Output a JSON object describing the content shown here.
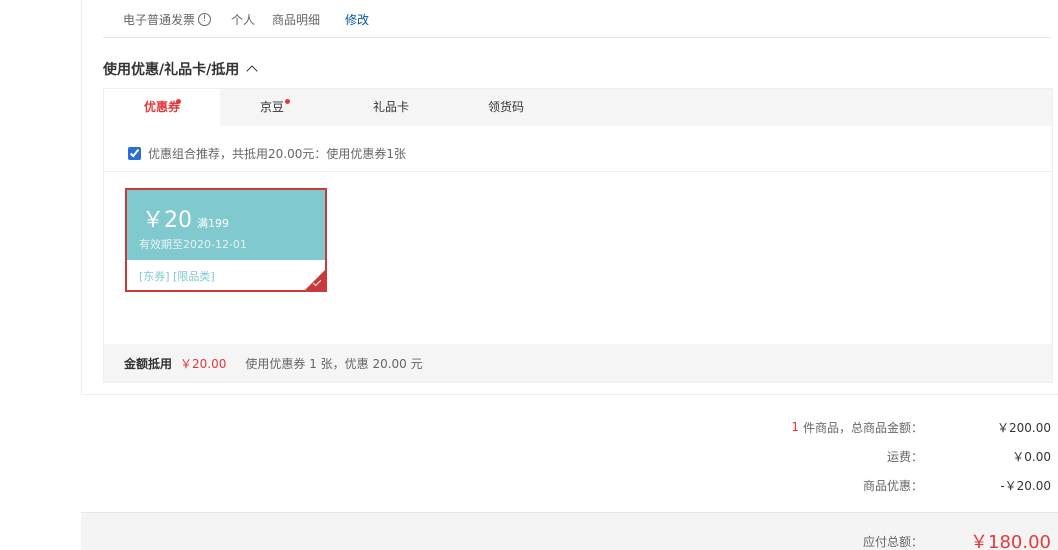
{
  "invoice": {
    "type": "电子普通发票",
    "info_icon": "!",
    "title": "个人",
    "content": "商品明细",
    "modify": "修改"
  },
  "discount_section": {
    "title": "使用优惠/礼品卡/抵用",
    "tabs": [
      {
        "label": "优惠券",
        "dot": true,
        "active": true
      },
      {
        "label": "京豆",
        "dot": true,
        "active": false
      },
      {
        "label": "礼品卡",
        "dot": false,
        "active": false
      },
      {
        "label": "领货码",
        "dot": false,
        "active": false
      }
    ],
    "recommend_text": "优惠组合推荐，共抵用20.00元：使用优惠券1张",
    "recommend_checked": true,
    "coupon": {
      "amount": "￥20",
      "condition": "满199",
      "expiry": "有效期至2020-12-01",
      "tags": "[东券] [限品类]",
      "selected": true,
      "color": "#7fc9cf"
    },
    "deduct": {
      "label": "金额抵用",
      "amount": "￥20.00",
      "desc": "使用优惠券 1 张，优惠 20.00 元"
    }
  },
  "summary": {
    "count": "1",
    "items_label": "件商品，总商品金额：",
    "items_value": "￥200.00",
    "shipping_label": "运费：",
    "shipping_value": "￥0.00",
    "discount_label": "商品优惠：",
    "discount_value": "-￥20.00",
    "total_label": "应付总额：",
    "total_value": "￥180.00"
  },
  "colors": {
    "accent_red": "#e4393c",
    "link_blue": "#005aa0",
    "coupon_teal": "#7fc9cf"
  }
}
